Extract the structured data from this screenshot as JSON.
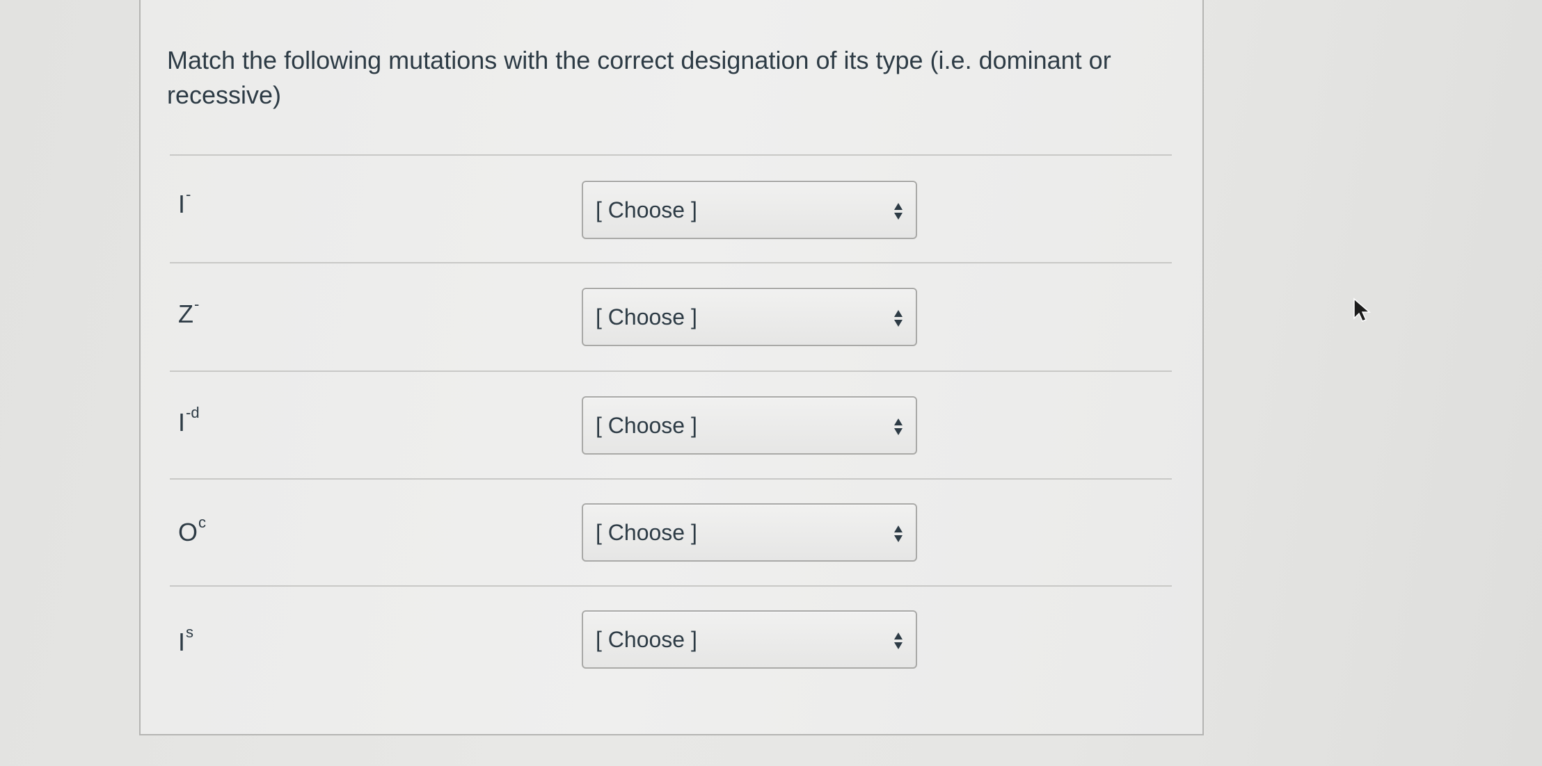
{
  "question": {
    "text": "Match the following mutations with the correct designation of its type (i.e. dominant or recessive)"
  },
  "rows": [
    {
      "base": "I",
      "sup": "-",
      "select": {
        "value": "[ Choose ]"
      }
    },
    {
      "base": "Z",
      "sup": "-",
      "select": {
        "value": "[ Choose ]"
      }
    },
    {
      "base": "I",
      "sup": "-d",
      "select": {
        "value": "[ Choose ]"
      }
    },
    {
      "base": "O",
      "sup": "c",
      "select": {
        "value": "[ Choose ]"
      }
    },
    {
      "base": "I",
      "sup": "s",
      "select": {
        "value": "[ Choose ]"
      }
    }
  ],
  "icons": {
    "select_arrows": "up-down-arrows-icon",
    "cursor": "mouse-pointer-icon"
  }
}
